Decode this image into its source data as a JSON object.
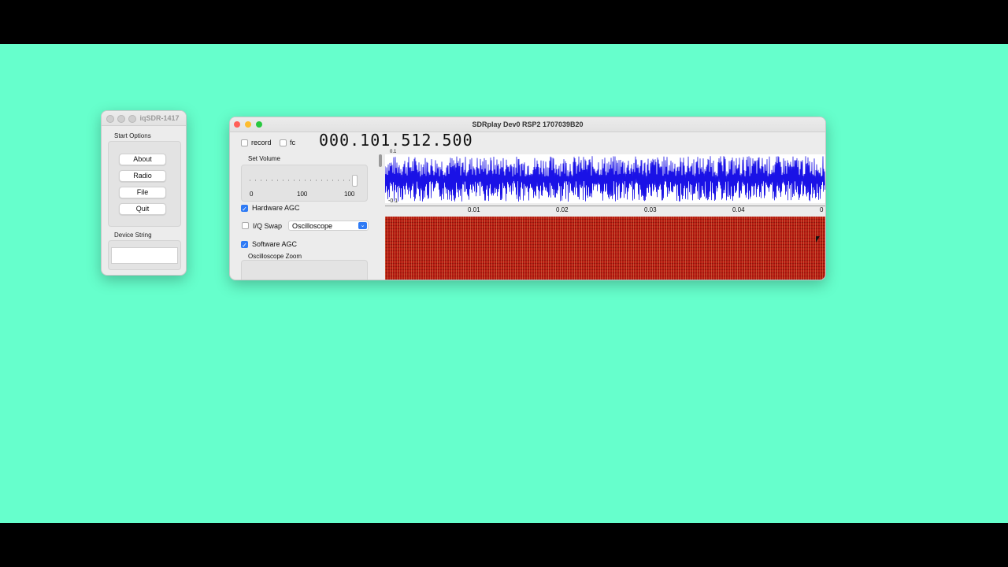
{
  "launcher": {
    "title": "iqSDR-1417",
    "start_options_label": "Start Options",
    "buttons": [
      "About",
      "Radio",
      "File",
      "Quit"
    ],
    "device_string_label": "Device String",
    "device_string_value": ""
  },
  "sdr": {
    "title": "SDRplay Dev0 RSP2 1707039B20",
    "record_label": "record",
    "record_checked": false,
    "fc_label": "fc",
    "fc_checked": false,
    "frequency": "000.101.512.500",
    "set_volume_label": "Set Volume",
    "volume_min": "0",
    "volume_mid": "100",
    "volume_max": "100",
    "volume_level": 1.0,
    "hardware_agc_label": "Hardware AGC",
    "hardware_agc_checked": true,
    "iq_swap_label": "I/Q Swap",
    "iq_swap_checked": false,
    "display_mode": "Oscilloscope",
    "software_agc_label": "Software AGC",
    "software_agc_checked": true,
    "oscilloscope_zoom_label": "Oscilloscope Zoom",
    "scope_axis_ticks": [
      "0.01",
      "0.02",
      "0.03",
      "0.04",
      "0"
    ],
    "scope_y_top": "0.1",
    "scope_y_bottom": "-0.1"
  },
  "colors": {
    "desktop": "#66ffcc",
    "scope_trace": "#1a12e6",
    "waterfall": "#b51a10",
    "accent": "#2f7bf5",
    "close": "#ff5f57",
    "minimize": "#febc2e",
    "zoom": "#28c840"
  }
}
